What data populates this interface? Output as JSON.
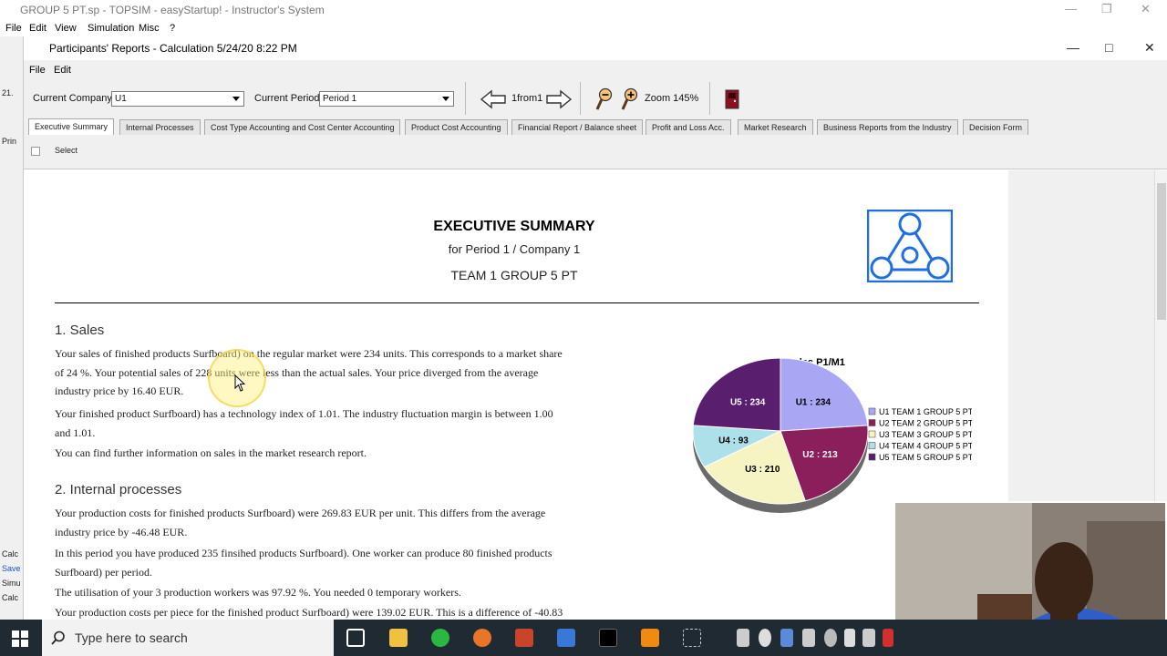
{
  "outer_window": {
    "title": "GROUP 5 PT.sp - TOPSIM - easyStartup! - Instructor's System",
    "menu": [
      "File",
      "Edit",
      "View",
      "Simulation",
      "Misc",
      "?"
    ]
  },
  "left_strip": {
    "labels": [
      "21.",
      "Prin",
      "Calc",
      "Save",
      "Simu",
      "Calc"
    ]
  },
  "inner_window": {
    "title": "Participants' Reports - Calculation 5/24/20 8:22 PM",
    "menu": [
      "File",
      "Edit"
    ]
  },
  "toolbar": {
    "company_label": "Current Company:",
    "company_value": "U1",
    "period_label": "Current Period:",
    "period_value": "Period 1",
    "page_text": "1from1",
    "zoom_text": "Zoom 145%"
  },
  "tabs": [
    "Executive Summary",
    "Internal Processes",
    "Cost Type Accounting and Cost Center Accounting",
    "Product Cost Accounting",
    "Financial Report / Balance sheet",
    "Profit and Loss Acc.",
    "Market Research",
    "Business Reports from the Industry",
    "Decision Form"
  ],
  "select_label": "Select",
  "report": {
    "title": "EXECUTIVE SUMMARY",
    "subtitle": "for Period 1 / Company 1",
    "team": "TEAM 1 GROUP 5 PT",
    "sales_heading": "1. Sales",
    "sales_p1_l1": "Your sales of finished products Surfboard) on the regular market were 234 units. This corresponds to a market share",
    "sales_p1_l2": "of 24 %. Your potential sales of 228 units were less than the actual sales. Your price diverged from the average",
    "sales_p1_l3": "industry price by 16.40 EUR.",
    "sales_p2_l1": "Your finished product Surfboard) has a technology index of 1.01. The industry fluctuation margin is between 1.00",
    "sales_p2_l2": "and 1.01.",
    "sales_p3": "You can find further information on sales in the market research report.",
    "internal_heading": "2. Internal processes",
    "int_p1_l1": "Your production costs for finished products Surfboard) were 269.83 EUR per unit. This differs from the average",
    "int_p1_l2": "industry price by -46.48 EUR.",
    "int_p2_l1": "In this period you have produced 235 finsihed products Surfboard). One worker can produce 80 finished products",
    "int_p2_l2": "Surfboard) per period.",
    "int_p3": "The utilisation of your 3 production workers was 97.92 %. You needed 0 temporary workers.",
    "int_p4": "Your production costs per piece for the finished product Surfboard) were 139.02 EUR. This is a difference of -40.83"
  },
  "chart_data": {
    "type": "pie",
    "title": "2. Sales P1/M1",
    "categories": [
      "U1",
      "U2",
      "U3",
      "U4",
      "U5"
    ],
    "values": [
      234,
      213,
      210,
      93,
      234
    ],
    "slice_labels": [
      "U1 : 234",
      "U2 : 213",
      "U3 : 210",
      "U4 : 93",
      "U5 : 234"
    ],
    "legend": [
      "U1 TEAM 1 GROUP 5 PT",
      "U2 TEAM 2 GROUP 5 PT",
      "U3 TEAM 3 GROUP 5 PT",
      "U4 TEAM 4 GROUP 5 PT",
      "U5 TEAM 5 GROUP 5 PT"
    ],
    "colors": [
      "#a9a6f3",
      "#8b1f5c",
      "#f7f4c4",
      "#aee0ea",
      "#5a1e6e"
    ],
    "legend_position": "right"
  },
  "taskbar": {
    "search_placeholder": "Type here to search"
  },
  "colors": {
    "accent_blue": "#1f6fe0",
    "taskbar": "#1f2a33"
  }
}
